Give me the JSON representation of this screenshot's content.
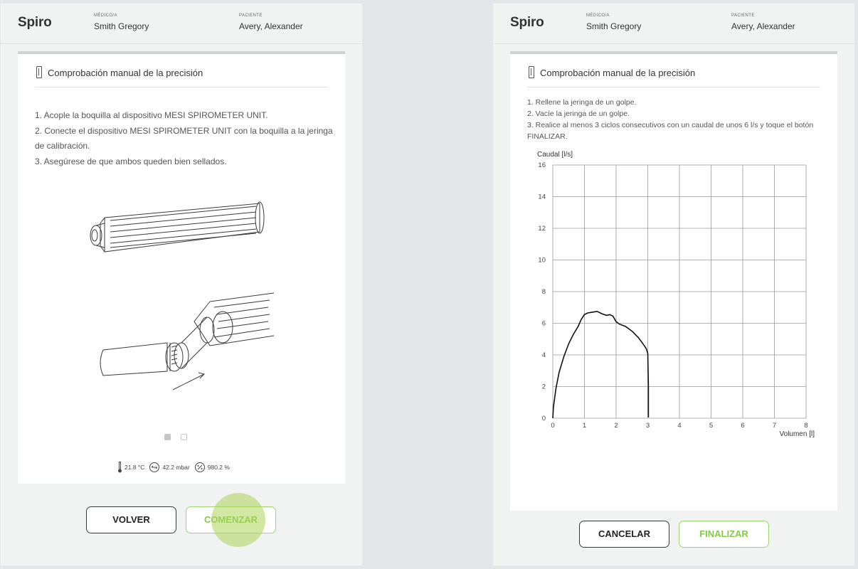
{
  "app": {
    "title": "Spiro"
  },
  "header": {
    "doctor_label": "MÉDICO/A",
    "doctor_name": "Smith Gregory",
    "patient_label": "PACIENTE",
    "patient_name": "Avery, Alexander"
  },
  "left_card": {
    "title": "Comprobación manual de la precisión",
    "steps": [
      "1. Acople la boquilla al dispositivo MESI SPIROMETER UNIT.",
      "2. Conecte el dispositivo MESI SPIROMETER UNIT con la boquilla a la jeringa de calibración.",
      "3. Asegúrese de que ambos queden bien sellados."
    ],
    "sensors": {
      "temperature": "21.8 °C",
      "pressure": "42.2 mbar",
      "humidity": "980.2 %"
    },
    "pager": {
      "pages": 2,
      "current": 1
    }
  },
  "left_buttons": {
    "back": "VOLVER",
    "start": "COMENZAR"
  },
  "right_card": {
    "title": "Comprobación manual de la precisión",
    "steps": [
      "1. Rellene la jeringa de un golpe.",
      "2. Vacíe la jeringa de un golpe.",
      "3. Realice al menos 3 ciclos consecutivos con un caudal de unos 6 l/s y toque el botón FINALIZAR."
    ]
  },
  "right_buttons": {
    "cancel": "CANCELAR",
    "finish": "FINALIZAR"
  },
  "colors": {
    "accent_green": "#84c94a",
    "ripple": "#b8d96a",
    "card_border": "#cfd2d3"
  },
  "icons": [
    "ruler-icon",
    "thermometer-icon",
    "pressure-icon",
    "humidity-icon"
  ],
  "chart_data": {
    "type": "line",
    "ylabel": "Caudal [l/s]",
    "xlabel": "Volumen [l]",
    "xlim": [
      0,
      8
    ],
    "ylim": [
      0,
      16
    ],
    "xticks": [
      0,
      1,
      2,
      3,
      4,
      5,
      6,
      7,
      8
    ],
    "yticks": [
      0,
      2,
      4,
      6,
      8,
      10,
      12,
      14,
      16
    ],
    "grid": true,
    "series": [
      {
        "x": [
          0,
          0.02,
          0.1,
          0.2,
          0.35,
          0.5,
          0.65,
          0.8,
          0.9,
          1.0,
          1.1,
          1.25,
          1.4,
          1.55,
          1.7,
          1.8,
          1.9,
          2.0,
          2.1,
          2.3,
          2.5,
          2.7,
          2.85,
          2.95,
          3.0,
          3.02,
          3.02
        ],
        "y": [
          0,
          0.7,
          1.9,
          2.9,
          3.9,
          4.7,
          5.3,
          5.8,
          6.25,
          6.55,
          6.65,
          6.7,
          6.75,
          6.6,
          6.5,
          6.55,
          6.45,
          6.1,
          5.95,
          5.8,
          5.5,
          5.1,
          4.7,
          4.4,
          4.1,
          2.0,
          0.05
        ]
      }
    ]
  }
}
